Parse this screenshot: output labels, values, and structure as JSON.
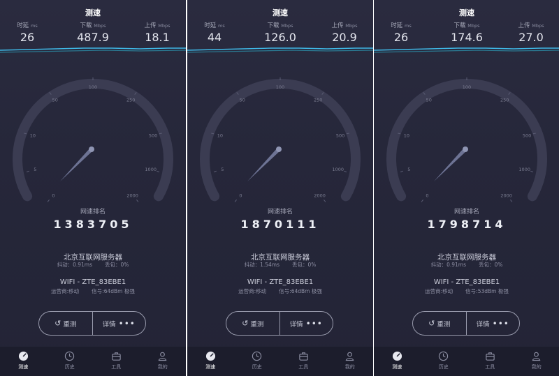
{
  "panels": [
    {
      "title": "测速",
      "stats": {
        "ping": {
          "label": "时延",
          "unit": "ms",
          "value": "26"
        },
        "download": {
          "label": "下载",
          "unit": "Mbps",
          "value": "487.9"
        },
        "upload": {
          "label": "上传",
          "unit": "Mbps",
          "value": "18.1"
        }
      },
      "gauge_ticks": [
        "0",
        "5",
        "10",
        "50",
        "100",
        "250",
        "500",
        "1000",
        "2000"
      ],
      "rank_label": "网速排名",
      "rank_value": "1383705",
      "server": {
        "name": "北京互联网服务器",
        "jitter": "抖动：0.91ms",
        "loss": "丢包：0%"
      },
      "wifi": {
        "name": "WIFI - ZTE_83EBE1",
        "operator": "运营商:移动",
        "signal": "信号:64dBm 极强"
      },
      "buttons": {
        "retest": "重测",
        "details": "详情"
      },
      "tabs": [
        "测速",
        "历史",
        "工具",
        "我的"
      ]
    },
    {
      "title": "测速",
      "stats": {
        "ping": {
          "label": "时延",
          "unit": "ms",
          "value": "44"
        },
        "download": {
          "label": "下载",
          "unit": "Mbps",
          "value": "126.0"
        },
        "upload": {
          "label": "上传",
          "unit": "Mbps",
          "value": "20.9"
        }
      },
      "gauge_ticks": [
        "0",
        "5",
        "10",
        "50",
        "100",
        "250",
        "500",
        "1000",
        "2000"
      ],
      "rank_label": "网速排名",
      "rank_value": "1870111",
      "server": {
        "name": "北京互联网服务器",
        "jitter": "抖动：1.54ms",
        "loss": "丢包：0%"
      },
      "wifi": {
        "name": "WIFI - ZTE_83EBE1",
        "operator": "运营商:移动",
        "signal": "信号:64dBm 极强"
      },
      "buttons": {
        "retest": "重测",
        "details": "详情"
      },
      "tabs": [
        "测速",
        "历史",
        "工具",
        "我的"
      ]
    },
    {
      "title": "测速",
      "stats": {
        "ping": {
          "label": "时延",
          "unit": "ms",
          "value": "26"
        },
        "download": {
          "label": "下载",
          "unit": "Mbps",
          "value": "174.6"
        },
        "upload": {
          "label": "上传",
          "unit": "Mbps",
          "value": "27.0"
        }
      },
      "gauge_ticks": [
        "0",
        "5",
        "10",
        "50",
        "100",
        "250",
        "500",
        "1000",
        "2000"
      ],
      "rank_label": "网速排名",
      "rank_value": "1798714",
      "server": {
        "name": "北京互联网服务器",
        "jitter": "抖动：0.91ms",
        "loss": "丢包：0%"
      },
      "wifi": {
        "name": "WIFI - ZTE_83EBE1",
        "operator": "运营商:移动",
        "signal": "信号:53dBm 极强"
      },
      "buttons": {
        "retest": "重测",
        "details": "详情"
      },
      "tabs": [
        "测速",
        "历史",
        "工具",
        "我的"
      ]
    }
  ],
  "icons": {
    "retest": "refresh-icon",
    "details": "more-dots-icon",
    "tabs": [
      "speedometer-icon",
      "clock-icon",
      "toolbox-icon",
      "user-icon"
    ]
  },
  "colors": {
    "background": "#26273a",
    "download_line": "#3fb8e6",
    "upload_line": "#2a8fa8",
    "gauge_track": "#3b3c52",
    "needle": "#6d7394",
    "tabbar": "#1c1d2c"
  }
}
